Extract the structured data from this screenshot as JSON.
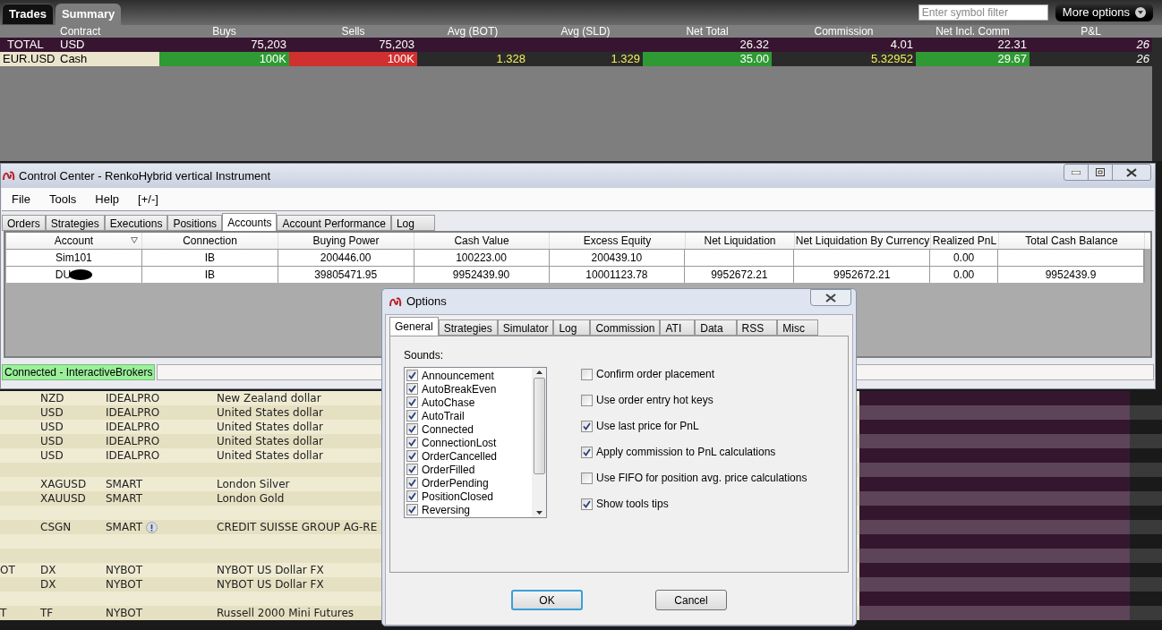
{
  "trades_panel": {
    "tabs": [
      {
        "label": "Trades",
        "selected": false
      },
      {
        "label": "Summary",
        "selected": true
      }
    ],
    "filter": {
      "placeholder": "Enter symbol filter"
    },
    "more_options": "More options",
    "columns": [
      "Contract",
      "Buys",
      "Sells",
      "Avg (BOT)",
      "Avg (SLD)",
      "Net Total",
      "Commission",
      "Net Incl. Comm",
      "P&L"
    ],
    "rows": [
      {
        "label": "TOTAL",
        "type": "USD",
        "kind": "total",
        "cells": [
          {
            "text": "75,203",
            "kind": "plain"
          },
          {
            "text": "75,203",
            "kind": "plain"
          },
          {
            "kind": "plain"
          },
          {
            "kind": "plain"
          },
          {
            "text": "26.32",
            "kind": "plain"
          },
          {
            "text": "4.01",
            "kind": "plain"
          },
          {
            "text": "22.31",
            "kind": "plain"
          },
          {
            "text": "26",
            "kind": "plain"
          }
        ]
      },
      {
        "label": "EUR.USD",
        "type": "Cash",
        "kind": "position",
        "cells": [
          {
            "text": "100K",
            "kind": "gain"
          },
          {
            "text": "100K",
            "kind": "loss"
          },
          {
            "text": "1.328",
            "kind": "quote"
          },
          {
            "text": "1.329",
            "kind": "quote"
          },
          {
            "text": "35.00",
            "kind": "gain"
          },
          {
            "text": "5.32952",
            "kind": "quote"
          },
          {
            "text": "29.67",
            "kind": "gain"
          },
          {
            "text": "26",
            "kind": "dim"
          }
        ]
      }
    ]
  },
  "control_center": {
    "title": "Control Center - RenkoHybrid vertical Instrument",
    "menu": [
      "File",
      "Tools",
      "Help",
      "[+/-]"
    ],
    "tabs": [
      {
        "label": "Orders",
        "selected": false
      },
      {
        "label": "Strategies",
        "selected": false
      },
      {
        "label": "Executions",
        "selected": false
      },
      {
        "label": "Positions",
        "selected": false
      },
      {
        "label": "Accounts",
        "selected": true
      },
      {
        "label": "Account Performance",
        "selected": false
      },
      {
        "label": "Log",
        "selected": false
      }
    ],
    "columns": [
      "Account",
      "Connection",
      "Buying Power",
      "Cash Value",
      "Excess Equity",
      "Net Liquidation",
      "Net Liquidation By Currency",
      "Realized PnL",
      "Total Cash Balance"
    ],
    "rows": [
      {
        "redacted": false,
        "cells": [
          "Sim101",
          "IB",
          "200446.00",
          "100223.00",
          "200439.10",
          null,
          null,
          "0.00",
          null
        ]
      },
      {
        "redacted": true,
        "cells": [
          "DU",
          "IB",
          "39805471.95",
          "9952439.90",
          "10001123.78",
          "9952672.21",
          "9952672.21",
          "0.00",
          "9952439.9"
        ]
      }
    ],
    "status": "Connected - InteractiveBrokers"
  },
  "watchlist": [
    {
      "kind": "quote",
      "symbol": "NZD",
      "exchange": "IDEALPRO",
      "description": "New Zealand dollar"
    },
    {
      "kind": "quote",
      "symbol": "USD",
      "exchange": "IDEALPRO",
      "description": "United States dollar"
    },
    {
      "kind": "quote",
      "symbol": "USD",
      "exchange": "IDEALPRO",
      "description": "United States dollar"
    },
    {
      "kind": "quote",
      "symbol": "USD",
      "exchange": "IDEALPRO",
      "description": "United States dollar"
    },
    {
      "kind": "quote",
      "symbol": "USD",
      "exchange": "IDEALPRO",
      "description": "United States dollar"
    },
    {
      "kind": "blank"
    },
    {
      "kind": "quote",
      "symbol": "XAGUSD",
      "exchange": "SMART",
      "description": "London Silver"
    },
    {
      "kind": "quote",
      "symbol": "XAUUSD",
      "exchange": "SMART",
      "description": "London Gold"
    },
    {
      "kind": "blank"
    },
    {
      "kind": "quote",
      "symbol": "CSGN",
      "exchange": "SMART",
      "alert": true,
      "description": "CREDIT SUISSE GROUP AG-RE"
    },
    {
      "kind": "blank"
    },
    {
      "kind": "blank"
    },
    {
      "kind": "quote",
      "column_1": "OT",
      "symbol": "DX",
      "exchange": "NYBOT",
      "description": "NYBOT US Dollar FX"
    },
    {
      "kind": "quote",
      "symbol": "DX",
      "exchange": "NYBOT",
      "description": "NYBOT US Dollar FX"
    },
    {
      "kind": "blank"
    },
    {
      "kind": "quote",
      "column_1": "T",
      "symbol": "TF",
      "exchange": "NYBOT",
      "description": "Russell 2000 Mini Futures"
    }
  ],
  "options_dialog": {
    "title": "Options",
    "tabs": [
      {
        "label": "General",
        "selected": true
      },
      {
        "label": "Strategies",
        "selected": false
      },
      {
        "label": "Simulator",
        "selected": false
      },
      {
        "label": "Log",
        "selected": false
      },
      {
        "label": "Commission",
        "selected": false
      },
      {
        "label": "ATI",
        "selected": false
      },
      {
        "label": "Data",
        "selected": false
      },
      {
        "label": "RSS",
        "selected": false
      },
      {
        "label": "Misc",
        "selected": false
      }
    ],
    "sounds_label": "Sounds:",
    "sounds": [
      {
        "label": "Announcement",
        "checked": true
      },
      {
        "label": "AutoBreakEven",
        "checked": true
      },
      {
        "label": "AutoChase",
        "checked": true
      },
      {
        "label": "AutoTrail",
        "checked": true
      },
      {
        "label": "Connected",
        "checked": true
      },
      {
        "label": "ConnectionLost",
        "checked": true
      },
      {
        "label": "OrderCancelled",
        "checked": true
      },
      {
        "label": "OrderFilled",
        "checked": true
      },
      {
        "label": "OrderPending",
        "checked": true
      },
      {
        "label": "PositionClosed",
        "checked": true
      },
      {
        "label": "Reversing",
        "checked": true
      }
    ],
    "settings": [
      {
        "label": "Confirm order placement",
        "checked": false
      },
      {
        "label": "Use order entry hot keys",
        "checked": false
      },
      {
        "label": "Use last price for PnL",
        "checked": true
      },
      {
        "label": "Apply commission to PnL calculations",
        "checked": true
      },
      {
        "label": "Use FIFO for position avg. price calculations",
        "checked": false
      },
      {
        "label": "Show tools tips",
        "checked": true
      }
    ],
    "buttons": [
      {
        "label": "OK",
        "default": true
      },
      {
        "label": "Cancel",
        "default": false
      }
    ]
  }
}
